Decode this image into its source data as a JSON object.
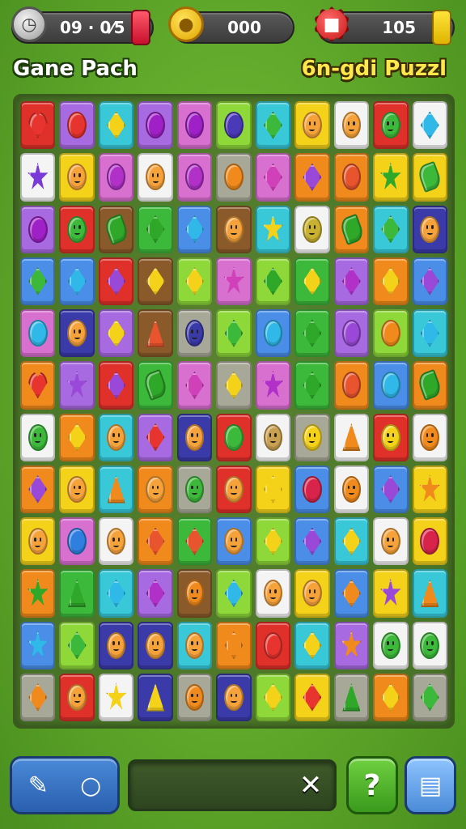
{
  "hud": {
    "timer_value": "09 · 0⁄5",
    "timer_icon": "clock-icon",
    "coins_value": "000",
    "coin_icon": "coin-icon",
    "gems_value": "105",
    "gem_icon": "gem-icon"
  },
  "titles": {
    "left": "Gane Pach",
    "right": "6n-gdi Puzzl"
  },
  "colors": {
    "background": "#5fa82a",
    "red": "#e8342e",
    "orange": "#f08a1c",
    "yellow": "#f5d21a",
    "green": "#3cb83a",
    "lime": "#8ed83a",
    "teal": "#2fc0c8",
    "blue": "#2f7fe0",
    "purple": "#9a48d8",
    "pink": "#d860c8",
    "white": "#f4f4f4",
    "navy": "#3a3aa8",
    "brown": "#8a5a2a",
    "gray": "#9a9a8a"
  },
  "board": {
    "columns": 11,
    "rows": [
      [
        [
          "red",
          "heart",
          "#e8342e"
        ],
        [
          "purple",
          "circle",
          "#e8342e"
        ],
        [
          "teal",
          "diamond",
          "#f5d21a"
        ],
        [
          "purple",
          "circle",
          "#a020c8"
        ],
        [
          "pink",
          "circle",
          "#a020c8"
        ],
        [
          "lime",
          "circle",
          "#4a3ab8"
        ],
        [
          "teal",
          "diamond",
          "#3cb83a"
        ],
        [
          "yellow",
          "face",
          "#f5a23a"
        ],
        [
          "white",
          "face",
          "#f5a23a"
        ],
        [
          "red",
          "face",
          "#3cb83a"
        ],
        [
          "white",
          "diamond",
          "#2fb8e8"
        ]
      ],
      [
        [
          "white",
          "star",
          "#7a3ad8"
        ],
        [
          "yellow",
          "face",
          "#f5a23a"
        ],
        [
          "pink",
          "circle",
          "#b030c8"
        ],
        [
          "white",
          "face",
          "#f5a23a"
        ],
        [
          "pink",
          "circle",
          "#b030c8"
        ],
        [
          "gray",
          "circle",
          "#f08a1c"
        ],
        [
          "pink",
          "diamond",
          "#d040b8"
        ],
        [
          "orange",
          "diamond",
          "#9a48d8"
        ],
        [
          "orange",
          "circle",
          "#e8542e"
        ],
        [
          "yellow",
          "star",
          "#2fa82a"
        ],
        [
          "yellow",
          "leaf",
          "#3cb83a"
        ]
      ],
      [
        [
          "purple",
          "circle",
          "#a020c8"
        ],
        [
          "red",
          "face",
          "#3cb83a"
        ],
        [
          "brown",
          "leaf",
          "#2fa82a"
        ],
        [
          "green",
          "diamond",
          "#2fa82a"
        ],
        [
          "blue",
          "diamond",
          "#2fb8e8"
        ],
        [
          "brown",
          "face",
          "#f5a23a"
        ],
        [
          "teal",
          "star",
          "#f5d21a"
        ],
        [
          "white",
          "face",
          "#c8b030"
        ],
        [
          "orange",
          "leaf",
          "#2fa82a"
        ],
        [
          "teal",
          "diamond",
          "#3cb83a"
        ],
        [
          "navy",
          "face",
          "#f5a23a"
        ]
      ],
      [
        [
          "blue",
          "diamond",
          "#3cb83a"
        ],
        [
          "blue",
          "diamond",
          "#2fb8e8"
        ],
        [
          "red",
          "diamond",
          "#9a48d8"
        ],
        [
          "brown",
          "diamond",
          "#f5d21a"
        ],
        [
          "lime",
          "diamond",
          "#f5d21a"
        ],
        [
          "pink",
          "star",
          "#d040b8"
        ],
        [
          "lime",
          "diamond",
          "#2fa82a"
        ],
        [
          "green",
          "diamond",
          "#f5d21a"
        ],
        [
          "purple",
          "diamond",
          "#b030c8"
        ],
        [
          "orange",
          "diamond",
          "#f5d21a"
        ],
        [
          "blue",
          "diamond",
          "#9a48d8"
        ]
      ],
      [
        [
          "pink",
          "circle",
          "#2fb8e8"
        ],
        [
          "navy",
          "face",
          "#f5a23a"
        ],
        [
          "purple",
          "diamond",
          "#f5d21a"
        ],
        [
          "brown",
          "tri",
          "#e8542e"
        ],
        [
          "gray",
          "face",
          "#3a3aa8"
        ],
        [
          "lime",
          "diamond",
          "#3cb83a"
        ],
        [
          "blue",
          "circle",
          "#2fb8e8"
        ],
        [
          "green",
          "diamond",
          "#2fa82a"
        ],
        [
          "purple",
          "circle",
          "#9a48d8"
        ],
        [
          "lime",
          "circle",
          "#f08a1c"
        ],
        [
          "teal",
          "diamond",
          "#2fb8e8"
        ]
      ],
      [
        [
          "orange",
          "heart",
          "#e8342e"
        ],
        [
          "purple",
          "star",
          "#9a48d8"
        ],
        [
          "red",
          "diamond",
          "#9a48d8"
        ],
        [
          "green",
          "leaf",
          "#2fa82a"
        ],
        [
          "pink",
          "diamond",
          "#d040b8"
        ],
        [
          "gray",
          "diamond",
          "#f5d21a"
        ],
        [
          "pink",
          "star",
          "#b030c8"
        ],
        [
          "green",
          "diamond",
          "#2fa82a"
        ],
        [
          "orange",
          "circle",
          "#e8542e"
        ],
        [
          "blue",
          "circle",
          "#2fb8e8"
        ],
        [
          "orange",
          "leaf",
          "#2fa82a"
        ]
      ],
      [
        [
          "white",
          "face",
          "#3cb83a"
        ],
        [
          "orange",
          "diamond",
          "#f5d21a"
        ],
        [
          "teal",
          "face",
          "#f5a23a"
        ],
        [
          "purple",
          "diamond",
          "#e8342e"
        ],
        [
          "navy",
          "face",
          "#f5a23a"
        ],
        [
          "red",
          "circle",
          "#3cb83a"
        ],
        [
          "white",
          "face",
          "#c8a050"
        ],
        [
          "gray",
          "face",
          "#f5d21a"
        ],
        [
          "white",
          "tri",
          "#f08a1c"
        ],
        [
          "red",
          "face",
          "#f5d21a"
        ],
        [
          "white",
          "face",
          "#f08a1c"
        ]
      ],
      [
        [
          "orange",
          "diamond",
          "#9a48d8"
        ],
        [
          "yellow",
          "face",
          "#f5a23a"
        ],
        [
          "teal",
          "tri",
          "#f08a1c"
        ],
        [
          "orange",
          "face",
          "#f5a23a"
        ],
        [
          "gray",
          "face",
          "#3cb83a"
        ],
        [
          "red",
          "face",
          "#f5a23a"
        ],
        [
          "yellow",
          "diamond",
          "#f5d21a"
        ],
        [
          "blue",
          "circle",
          "#d8244a"
        ],
        [
          "white",
          "face",
          "#f08a1c"
        ],
        [
          "blue",
          "diamond",
          "#9a48d8"
        ],
        [
          "yellow",
          "star",
          "#f08a1c"
        ]
      ],
      [
        [
          "yellow",
          "face",
          "#f5a23a"
        ],
        [
          "pink",
          "circle",
          "#2f7fe0"
        ],
        [
          "white",
          "face",
          "#f5a23a"
        ],
        [
          "orange",
          "diamond",
          "#e8542e"
        ],
        [
          "green",
          "diamond",
          "#e8542e"
        ],
        [
          "blue",
          "face",
          "#f5a23a"
        ],
        [
          "lime",
          "diamond",
          "#f5d21a"
        ],
        [
          "blue",
          "diamond",
          "#9a48d8"
        ],
        [
          "teal",
          "diamond",
          "#f5d21a"
        ],
        [
          "white",
          "face",
          "#f5a23a"
        ],
        [
          "yellow",
          "circle",
          "#d8244a"
        ]
      ],
      [
        [
          "orange",
          "star",
          "#2fa82a"
        ],
        [
          "green",
          "tri",
          "#2fa82a"
        ],
        [
          "teal",
          "diamond",
          "#2fb8e8"
        ],
        [
          "purple",
          "diamond",
          "#b030c8"
        ],
        [
          "brown",
          "face",
          "#f08a1c"
        ],
        [
          "lime",
          "diamond",
          "#2fb8e8"
        ],
        [
          "white",
          "face",
          "#f5a23a"
        ],
        [
          "yellow",
          "face",
          "#f5a23a"
        ],
        [
          "blue",
          "diamond",
          "#f08a1c"
        ],
        [
          "yellow",
          "star",
          "#9a48d8"
        ],
        [
          "teal",
          "tri",
          "#f08a1c"
        ]
      ],
      [
        [
          "blue",
          "star",
          "#2fb8e8"
        ],
        [
          "lime",
          "diamond",
          "#3cb83a"
        ],
        [
          "navy",
          "face",
          "#f5a23a"
        ],
        [
          "navy",
          "face",
          "#f5a23a"
        ],
        [
          "teal",
          "face",
          "#f5a23a"
        ],
        [
          "orange",
          "diamond",
          "#f08a1c"
        ],
        [
          "red",
          "circle",
          "#e8342e"
        ],
        [
          "teal",
          "diamond",
          "#f5d21a"
        ],
        [
          "purple",
          "star",
          "#f08a1c"
        ],
        [
          "white",
          "face",
          "#3cb83a"
        ],
        [
          "white",
          "face",
          "#3cb83a"
        ]
      ],
      [
        [
          "gray",
          "diamond",
          "#f08a1c"
        ],
        [
          "red",
          "face",
          "#f5a23a"
        ],
        [
          "white",
          "star",
          "#f5d21a"
        ],
        [
          "navy",
          "tri",
          "#f5d21a"
        ],
        [
          "gray",
          "face",
          "#f08a1c"
        ],
        [
          "navy",
          "face",
          "#f5a23a"
        ],
        [
          "lime",
          "diamond",
          "#f5d21a"
        ],
        [
          "yellow",
          "diamond",
          "#e8342e"
        ],
        [
          "gray",
          "tri",
          "#2fa82a"
        ],
        [
          "orange",
          "diamond",
          "#f5d21a"
        ],
        [
          "gray",
          "diamond",
          "#3cb83a"
        ]
      ]
    ]
  },
  "bottom_bar": {
    "tools_left_icon": "pencil-icon",
    "tools_right_icon": "ring-icon",
    "close_label": "✕",
    "help_label": "?",
    "menu_icon": "menu-icon",
    "progress": 0.0
  }
}
